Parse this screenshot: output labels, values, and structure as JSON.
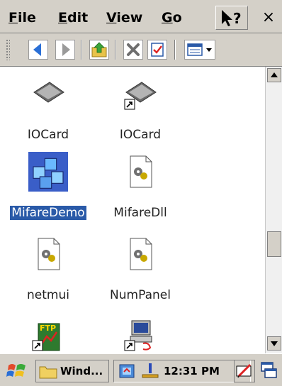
{
  "menubar": {
    "items": [
      {
        "accel": "F",
        "rest": "ile"
      },
      {
        "accel": "E",
        "rest": "dit"
      },
      {
        "accel": "V",
        "rest": "iew"
      },
      {
        "accel": "G",
        "rest": "o"
      }
    ],
    "close_label": "×"
  },
  "toolbar": {
    "icons": [
      "back-arrow-icon",
      "forward-arrow-icon",
      "up-folder-icon",
      "delete-icon",
      "properties-icon",
      "view-options-icon"
    ]
  },
  "files": [
    {
      "label": "IOCard",
      "icon": "card-icon",
      "shortcut": false
    },
    {
      "label": "IOCard",
      "icon": "card-icon",
      "shortcut": true
    },
    {
      "label": "MifareDemo",
      "icon": "app-cubes-icon",
      "selected": true
    },
    {
      "label": "MifareDll",
      "icon": "dll-file-icon"
    },
    {
      "label": "netmui",
      "icon": "dll-file-icon"
    },
    {
      "label": "NumPanel",
      "icon": "dll-file-icon"
    },
    {
      "label": "",
      "icon": "ftp-shortcut-icon",
      "shortcut": true
    },
    {
      "label": "",
      "icon": "computer-shortcut-icon",
      "shortcut": true
    }
  ],
  "taskbar": {
    "task_label": "Wind...",
    "clock": "12:31 PM"
  }
}
